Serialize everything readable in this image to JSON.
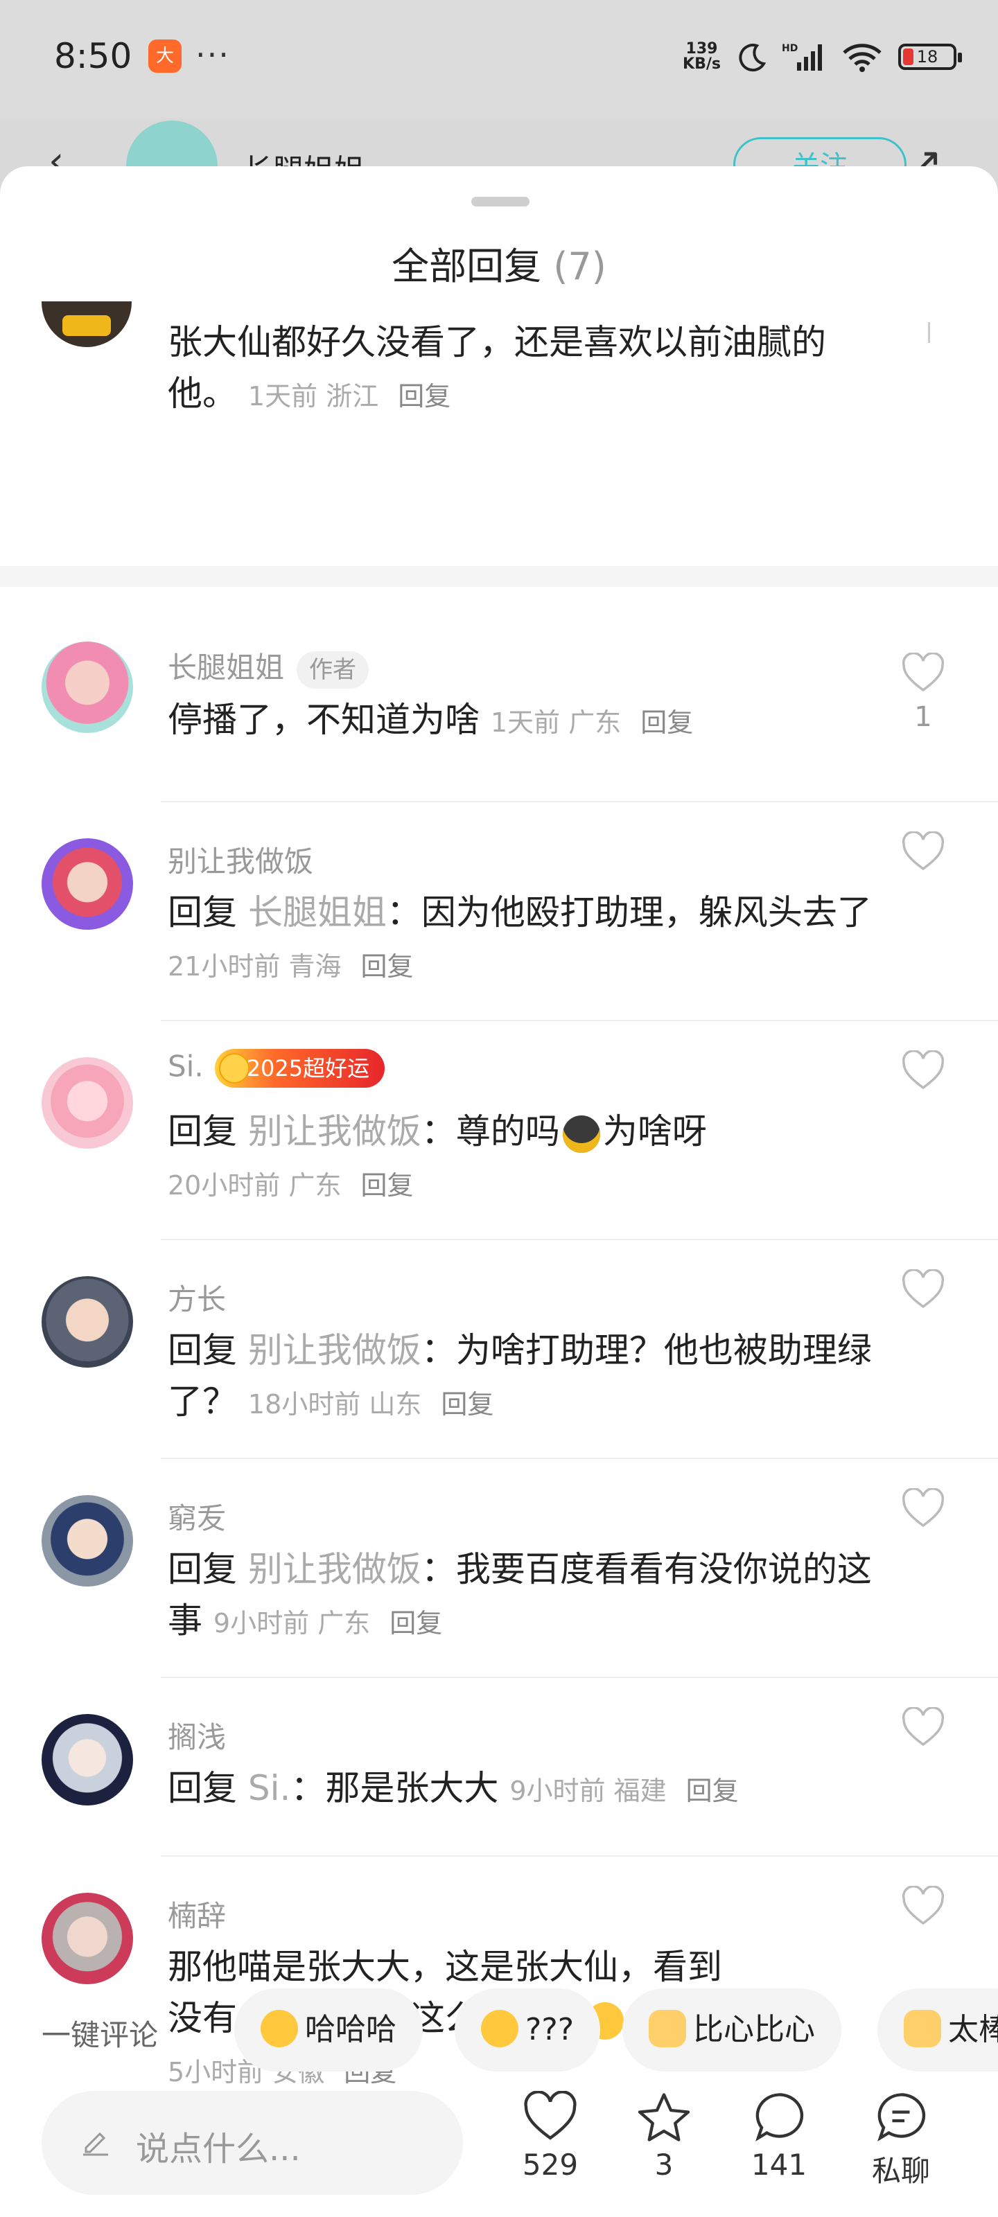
{
  "status_bar": {
    "time": "8:50",
    "app_badge": "大",
    "dots": "···",
    "net_speed_top": "139",
    "net_speed_unit": "KB/s",
    "battery": "18"
  },
  "header": {
    "name": "长腿姐姐",
    "follow": "关注"
  },
  "sheet": {
    "title": "全部回复",
    "count": "(7)",
    "top_comment": {
      "text": "张大仙都好久没看了，还是喜欢以前油腻的他。",
      "time": "1天前",
      "location": "浙江",
      "reply": "回复"
    }
  },
  "replies": [
    {
      "name": "长腿姐姐",
      "tag": "作者",
      "text": "停播了，不知道为啥",
      "time": "1天前",
      "location": "广东",
      "reply": "回复",
      "likes": "1"
    },
    {
      "name": "别让我做饭",
      "reply_prefix": "回复",
      "reply_to": "长腿姐姐",
      "text": "：因为他殴打助理，躲风头去了",
      "time": "21小时前",
      "location": "青海",
      "reply": "回复"
    },
    {
      "name": "Si.",
      "badge": "2025超好运",
      "reply_prefix": "回复",
      "reply_to": "别让我做饭",
      "text": "：尊的吗",
      "text_after_emoji": "为啥呀",
      "time": "20小时前",
      "location": "广东",
      "reply": "回复"
    },
    {
      "name": "方长",
      "reply_prefix": "回复",
      "reply_to": "别让我做饭",
      "text": "：为啥打助理？他也被助理绿了？",
      "time": "18小时前",
      "location": "山东",
      "reply": "回复"
    },
    {
      "name": "窮叐",
      "reply_prefix": "回复",
      "reply_to": "别让我做饭",
      "text": "：我要百度看看有没你说的这事",
      "time": "9小时前",
      "location": "广东",
      "reply": "回复"
    },
    {
      "name": "搁浅",
      "reply_prefix": "回复",
      "reply_to": "Si.",
      "text": "：那是张大大",
      "time": "9小时前",
      "location": "福建",
      "reply": "回复"
    },
    {
      "name": "楠辞",
      "text": "那他喵是张大大，这是张大仙，看到没有，谣言，就这么起来的",
      "time": "5小时前",
      "location": "安徽",
      "reply": "回复"
    }
  ],
  "quick_comments": {
    "label": "一键评论",
    "chips": [
      "哈哈哈",
      "???",
      "比心比心",
      "太棒"
    ]
  },
  "bottom": {
    "placeholder": "说点什么...",
    "likes": "529",
    "stars": "3",
    "comments": "141",
    "dm": "私聊"
  },
  "colors": {
    "accent": "#3fc1c9",
    "badge": "#e7262b"
  }
}
